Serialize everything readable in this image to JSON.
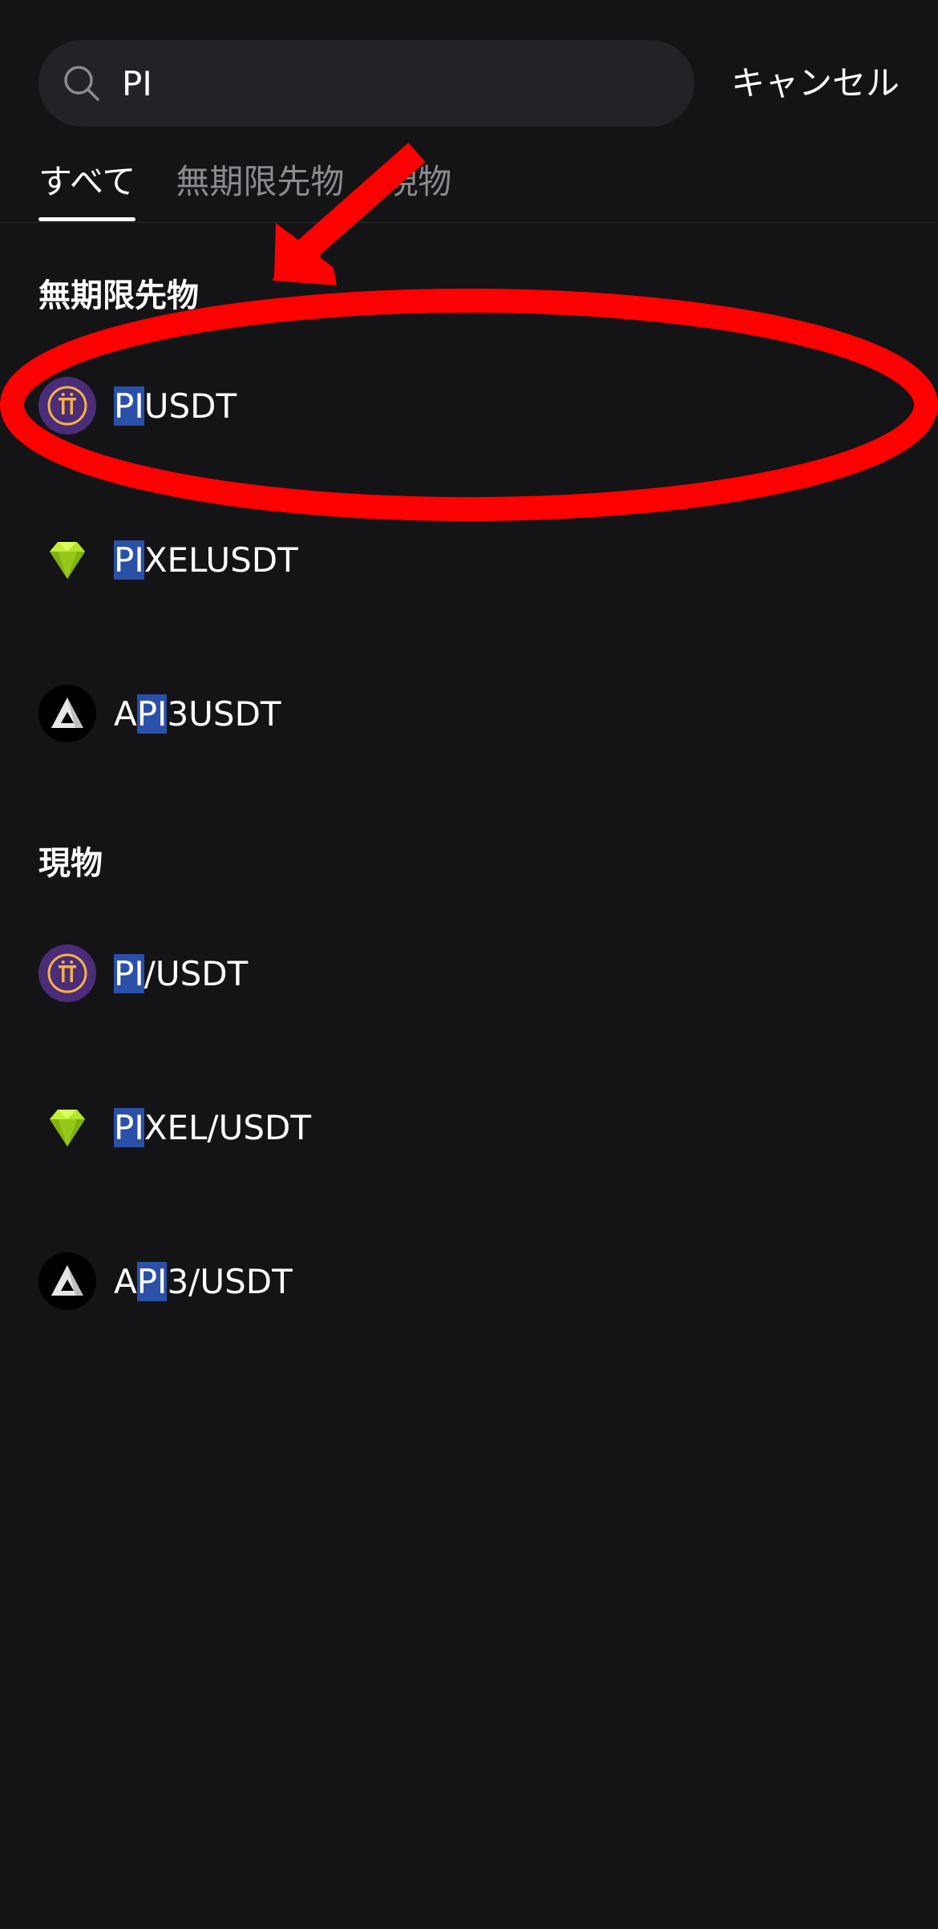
{
  "search": {
    "value": "PI",
    "placeholder": ""
  },
  "cancel_label": "キャンセル",
  "tabs": [
    {
      "label": "すべて",
      "active": true
    },
    {
      "label": "無期限先物",
      "active": false
    },
    {
      "label": "現物",
      "active": false
    }
  ],
  "sections": [
    {
      "title": "無期限先物",
      "items": [
        {
          "pre": "",
          "match": "PI",
          "post": "USDT",
          "icon": "pi-coin-icon"
        },
        {
          "pre": "",
          "match": "PI",
          "post": "XELUSDT",
          "icon": "gem-icon"
        },
        {
          "pre": "A",
          "match": "PI",
          "post": "3USDT",
          "icon": "api3-icon"
        }
      ]
    },
    {
      "title": "現物",
      "items": [
        {
          "pre": "",
          "match": "PI",
          "post": "/USDT",
          "icon": "pi-coin-icon"
        },
        {
          "pre": "",
          "match": "PI",
          "post": "XEL/USDT",
          "icon": "gem-icon"
        },
        {
          "pre": "A",
          "match": "PI",
          "post": "3/USDT",
          "icon": "api3-icon"
        }
      ]
    }
  ],
  "colors": {
    "background": "#141416",
    "search_bg": "#222326",
    "highlight": "#2a50a8",
    "annotation": "#ff0000",
    "pi_purple": "#4a2c78",
    "pi_gold": "#f3b24a"
  }
}
